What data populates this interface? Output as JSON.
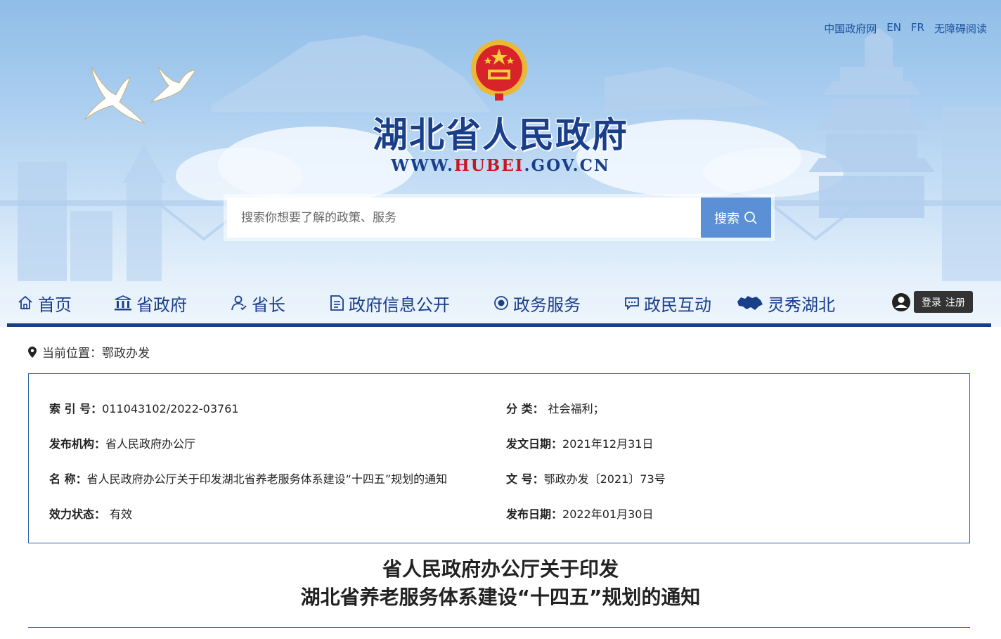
{
  "top_links": [
    "中国政府网",
    "EN",
    "FR",
    "无障碍阅读"
  ],
  "site": {
    "title": "湖北省人民政府",
    "url_prefix": "WWW.",
    "url_highlight": "HUBEI",
    "url_suffix": ".GOV.CN"
  },
  "search": {
    "placeholder": "搜索你想要了解的政策、服务",
    "button_label": "搜索"
  },
  "nav": [
    {
      "label": "首页",
      "icon": "home-icon"
    },
    {
      "label": "省政府",
      "icon": "building-icon"
    },
    {
      "label": "省长",
      "icon": "person-icon"
    },
    {
      "label": "政府信息公开",
      "icon": "document-icon"
    },
    {
      "label": "政务服务",
      "icon": "service-icon"
    },
    {
      "label": "政民互动",
      "icon": "chat-icon"
    },
    {
      "label": "灵秀湖北",
      "icon": "hubei-map-icon"
    }
  ],
  "user": {
    "login_label": "登录",
    "register_label": "注册"
  },
  "breadcrumb": {
    "prefix": "当前位置：",
    "current": "鄂政办发"
  },
  "meta": {
    "index_label": "索 引 号：",
    "index_value": "011043102/2022-03761",
    "category_label": "分 类：",
    "category_value": "社会福利；",
    "publisher_label": "发布机构：",
    "publisher_value": "省人民政府办公厅",
    "issue_date_label": "发文日期：",
    "issue_date_value": "2021年12月31日",
    "name_label": "名 称：",
    "name_value": "省人民政府办公厅关于印发湖北省养老服务体系建设“十四五”规划的通知",
    "doc_no_label": "文 号：",
    "doc_no_value": "鄂政办发〔2021〕73号",
    "status_label": "效力状态：",
    "status_value": "有效",
    "publish_date_label": "发布日期：",
    "publish_date_value": "2022年01月30日"
  },
  "document": {
    "title_line1": "省人民政府办公厅关于印发",
    "title_line2": "湖北省养老服务体系建设“十四五”规划的通知"
  },
  "colors": {
    "brand_blue": "#1a3f8a",
    "accent_red": "#c8161d",
    "search_button": "#5b8fd6"
  }
}
